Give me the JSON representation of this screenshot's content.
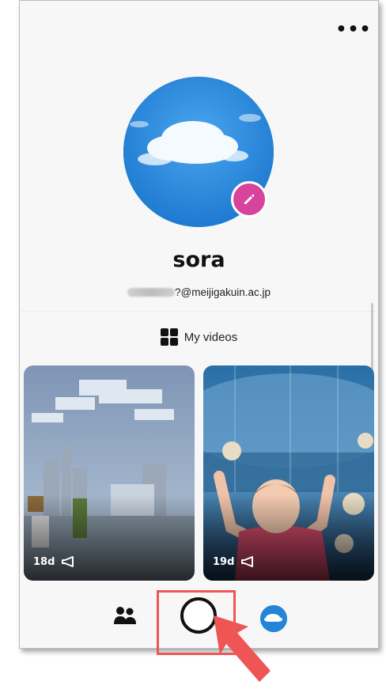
{
  "profile": {
    "username": "sora",
    "email_visible": "?@meijigakuin.ac.jp"
  },
  "section": {
    "my_videos_label": "My videos"
  },
  "videos": [
    {
      "age": "18d",
      "icon": "megaphone-icon"
    },
    {
      "age": "19d",
      "icon": "megaphone-icon"
    }
  ],
  "nav": {
    "items": [
      "people-icon",
      "record-button",
      "profile-avatar"
    ]
  },
  "colors": {
    "edit_button": "#d6449b",
    "highlight": "#ee5555",
    "background": "#f7f7f7"
  }
}
